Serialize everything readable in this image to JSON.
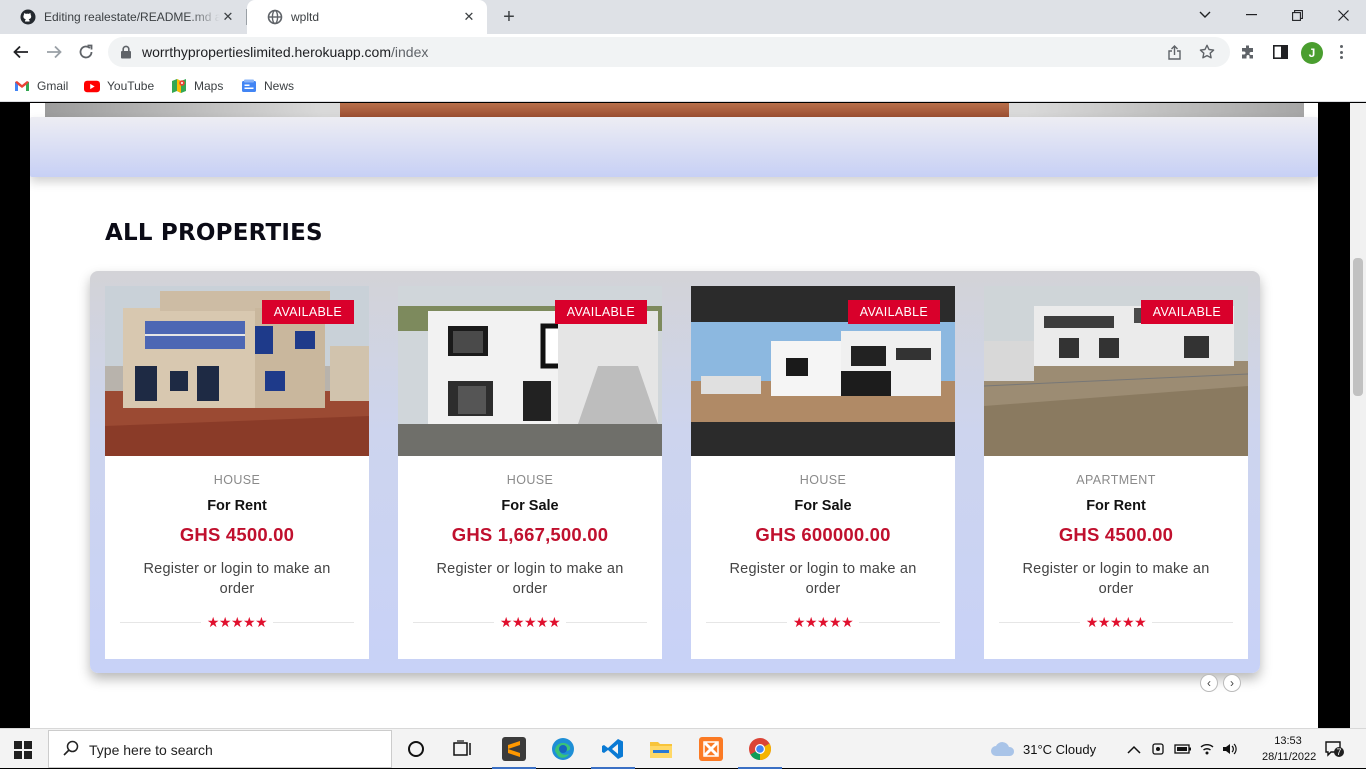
{
  "browser": {
    "tabs": [
      {
        "title": "Editing realestate/README.md at",
        "icon": "github-icon",
        "active": false
      },
      {
        "title": "wpltd",
        "icon": "globe-icon",
        "active": true
      }
    ],
    "url_domain": "worrthypropertieslimited.herokuapp.com",
    "url_path": "/index",
    "profile_initial": "J",
    "bookmarks": [
      {
        "label": "Gmail",
        "icon": "gmail-icon"
      },
      {
        "label": "YouTube",
        "icon": "youtube-icon"
      },
      {
        "label": "Maps",
        "icon": "maps-icon"
      },
      {
        "label": "News",
        "icon": "news-icon"
      }
    ]
  },
  "page": {
    "section_title": "ALL PROPERTIES",
    "properties": [
      {
        "badge": "AVAILABLE",
        "type": "HOUSE",
        "deal": "For Rent",
        "price": "GHS 4500.00",
        "note": "Register or login to make an order",
        "rating": 5,
        "stars": "★★★★★"
      },
      {
        "badge": "AVAILABLE",
        "type": "HOUSE",
        "deal": "For Sale",
        "price": "GHS 1,667,500.00",
        "note": "Register or login to make an order",
        "rating": 5,
        "stars": "★★★★★"
      },
      {
        "badge": "AVAILABLE",
        "type": "HOUSE",
        "deal": "For Sale",
        "price": "GHS 600000.00",
        "note": "Register or login to make an order",
        "rating": 5,
        "stars": "★★★★★"
      },
      {
        "badge": "AVAILABLE",
        "type": "APARTMENT",
        "deal": "For Rent",
        "price": "GHS 4500.00",
        "note": "Register or login to make an order",
        "rating": 5,
        "stars": "★★★★★"
      }
    ],
    "accent_color": "#d9002b"
  },
  "taskbar": {
    "search_placeholder": "Type here to search",
    "weather": "31°C  Cloudy",
    "time": "13:53",
    "date": "28/11/2022",
    "notification_count": "7"
  }
}
